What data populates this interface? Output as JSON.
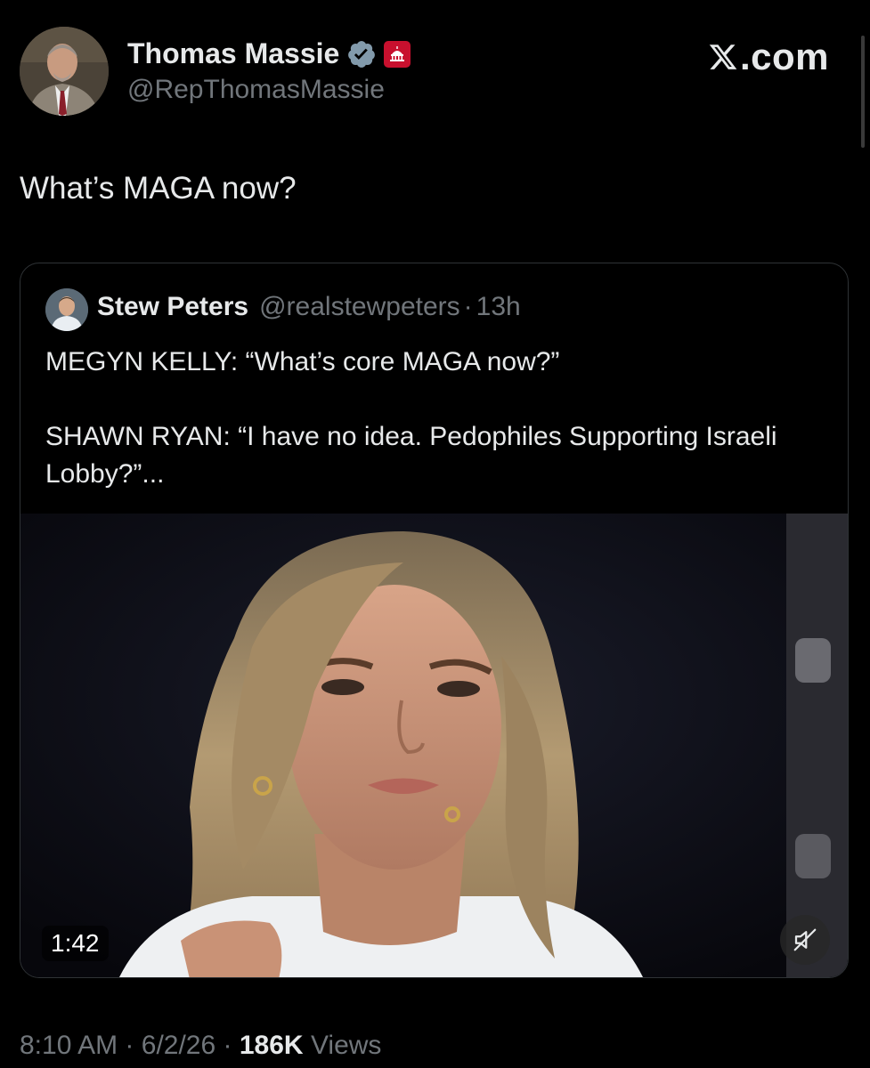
{
  "author": {
    "name": "Thomas Massie",
    "handle": "@RepThomasMassie",
    "verified": true,
    "affiliation_icon": "capitol-dome-icon",
    "affiliation_color": "#c8102e"
  },
  "brand": {
    "label": ".com",
    "icon": "x-logo-icon"
  },
  "tweet": {
    "text": "What’s MAGA now?"
  },
  "quoted": {
    "name": "Stew Peters",
    "handle": "@realstewpeters",
    "separator": "·",
    "time": "13h",
    "text": "MEGYN KELLY: “What’s core MAGA now?”\n\nSHAWN RYAN: “I have no idea. Pedophiles Supporting Israeli Lobby?”...",
    "video": {
      "duration": "1:42",
      "mute_icon": "muted-speaker-icon"
    }
  },
  "meta": {
    "time": "8:10 AM",
    "separator": "·",
    "date": "6/2/26",
    "views_count": "186K",
    "views_label": "Views"
  },
  "colors": {
    "background": "#000000",
    "text_primary": "#e7e9ea",
    "text_secondary": "#71767b",
    "verified_badge": "#829aab",
    "border": "#2f3336"
  }
}
